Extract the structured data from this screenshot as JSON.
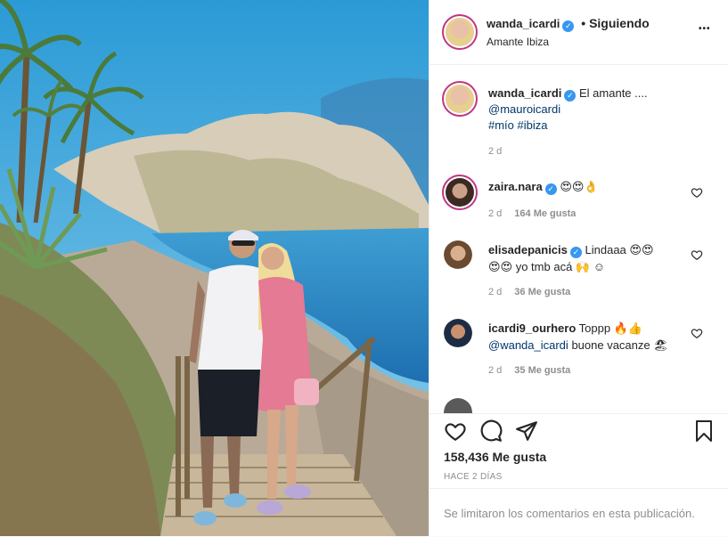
{
  "post": {
    "username": "wanda_icardi",
    "separator": "•",
    "follow_status": "Siguiendo",
    "location": "Amante Ibiza",
    "more_label": "•••"
  },
  "caption": {
    "username": "wanda_icardi",
    "text": "El amante ....",
    "mention": "@mauroicardi",
    "hashtags": "#mío #ibiza",
    "time": "2 d"
  },
  "comments": [
    {
      "username": "zaira.nara",
      "verified": true,
      "text": "😍😍👌",
      "text2": "",
      "mention": "",
      "time": "2 d",
      "likes": "164 Me gusta"
    },
    {
      "username": "elisadepanicis",
      "verified": true,
      "text": "Lindaaa 😍😍",
      "text2": "😍😍 yo tmb acá 🙌 ☺",
      "mention": "",
      "time": "2 d",
      "likes": "36 Me gusta"
    },
    {
      "username": "icardi9_ourhero",
      "verified": false,
      "text": "Toppp 🔥👍",
      "mention": "@wanda_icardi",
      "text2": "buone vacanze 🏖",
      "time": "2 d",
      "likes": "35 Me gusta"
    }
  ],
  "actions": {
    "likes": "158,436 Me gusta",
    "time": "HACE 2 DÍAS"
  },
  "comment_box": {
    "notice": "Se limitaron los comentarios en esta publicación."
  },
  "colors": {
    "sky": "#4aaee0",
    "sea": "#2f8fd0",
    "link": "#00376b",
    "verified": "#3897f0",
    "story_ring": "#c13584"
  }
}
